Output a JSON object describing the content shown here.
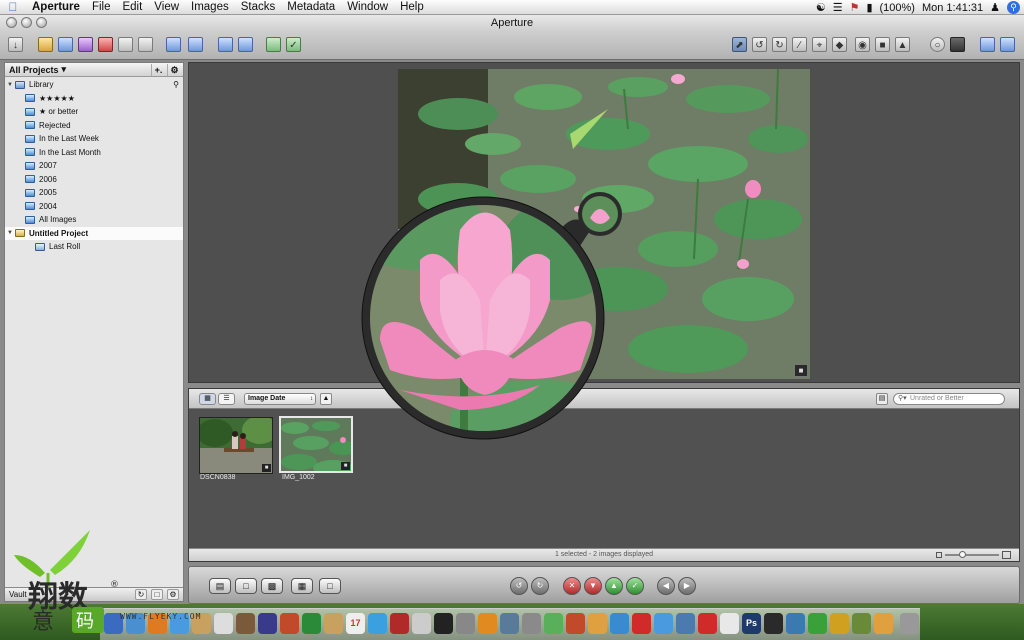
{
  "menubar": {
    "app_name": "Aperture",
    "items": [
      "File",
      "Edit",
      "View",
      "Images",
      "Stacks",
      "Metadata",
      "Window",
      "Help"
    ],
    "battery": "(100%)",
    "clock": "Mon 1:41:31"
  },
  "window": {
    "title": "Aperture"
  },
  "sidebar": {
    "header": "All Projects",
    "library_label": "Library",
    "albums": [
      "★★★★★",
      "★ or better",
      "Rejected",
      "In the Last Week",
      "In the Last Month",
      "2007",
      "2006",
      "2005",
      "2004",
      "All Images"
    ],
    "project_label": "Untitled Project",
    "roll_label": "Last Roll",
    "footer_label": "Vault"
  },
  "browser": {
    "sort_popup": "Image Date",
    "search_placeholder": "Unrated or Better",
    "thumbnails": [
      {
        "label": "DSCN0838"
      },
      {
        "label": "IMG_1002"
      }
    ],
    "status_text": "1 selected - 2 images displayed"
  },
  "watermark": {
    "site": "WWW.FLYEKY.COM"
  },
  "colors": {
    "viewer_bg": "#4f4f4f",
    "lotus_pink": "#f07ab8",
    "leaf_green": "#4f9a5c"
  }
}
